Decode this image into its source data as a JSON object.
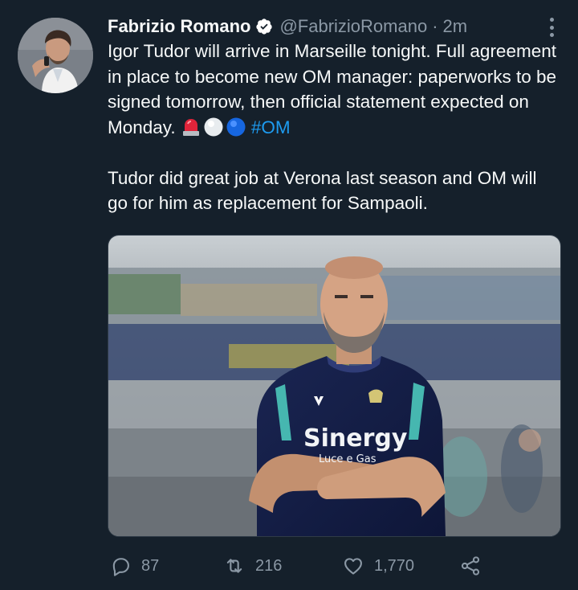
{
  "tweet": {
    "author": {
      "name": "Fabrizio Romano",
      "handle": "@FabrizioRomano",
      "time": "2m",
      "separator": "·"
    },
    "text": {
      "para1": "Igor Tudor will arrive in Marseille tonight. Full agreement in place to become new OM manager: paperworks to be signed tomorrow, then official statement expected on Monday.",
      "para1_emojis": [
        "rotating-light-emoji",
        "white-circle-emoji",
        "blue-circle-emoji"
      ],
      "hashtag": "#OM",
      "para2": "Tudor did great job at Verona last season and OM will go for him as replacement for Sampaoli."
    },
    "media": {
      "shirt_sponsor": "Sinergy",
      "shirt_sub_sponsor": "Luce e Gas"
    },
    "actions": {
      "replies": "87",
      "retweets": "216",
      "likes": "1,770"
    },
    "colors": {
      "background": "#15202b",
      "text": "#f7f9f9",
      "secondary": "#8b98a5",
      "link": "#1d9bf0",
      "verified": "#ffffff"
    }
  }
}
